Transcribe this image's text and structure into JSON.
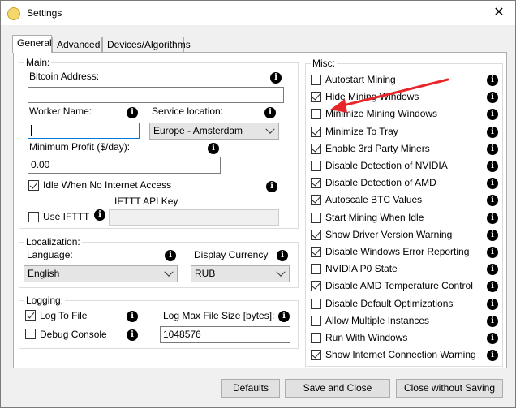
{
  "window": {
    "title": "Settings",
    "close_glyph": "✕"
  },
  "tabs": [
    {
      "label": "General",
      "active": true
    },
    {
      "label": "Advanced",
      "active": false
    },
    {
      "label": "Devices/Algorithms",
      "active": false
    }
  ],
  "main": {
    "legend": "Main:",
    "bitcoin_address_label": "Bitcoin Address:",
    "bitcoin_address_value": "",
    "worker_name_label": "Worker Name:",
    "worker_name_value": "",
    "service_location_label": "Service location:",
    "service_location_value": "Europe - Amsterdam",
    "min_profit_label": "Minimum Profit ($/day):",
    "min_profit_value": "0.00",
    "idle_no_internet_label": "Idle When No Internet Access",
    "idle_no_internet_checked": true,
    "use_ifttt_label": "Use IFTTT",
    "use_ifttt_checked": false,
    "ifttt_api_key_label": "IFTTT API Key",
    "ifttt_api_key_value": ""
  },
  "localization": {
    "legend": "Localization:",
    "language_label": "Language:",
    "language_value": "English",
    "currency_label": "Display Currency",
    "currency_value": "RUB"
  },
  "logging": {
    "legend": "Logging:",
    "log_to_file_label": "Log To File",
    "log_to_file_checked": true,
    "debug_console_label": "Debug Console",
    "debug_console_checked": false,
    "max_size_label": "Log Max File Size [bytes]:",
    "max_size_value": "1048576"
  },
  "misc": {
    "legend": "Misc:",
    "items": [
      {
        "label": "Autostart Mining",
        "checked": false
      },
      {
        "label": "Hide Mining Windows",
        "checked": true
      },
      {
        "label": "Minimize Mining Windows",
        "checked": false
      },
      {
        "label": "Minimize To Tray",
        "checked": true
      },
      {
        "label": "Enable 3rd Party Miners",
        "checked": true
      },
      {
        "label": "Disable Detection of NVIDIA",
        "checked": false
      },
      {
        "label": "Disable Detection of AMD",
        "checked": true
      },
      {
        "label": "Autoscale BTC Values",
        "checked": true
      },
      {
        "label": "Start Mining When Idle",
        "checked": false
      },
      {
        "label": "Show Driver Version Warning",
        "checked": true
      },
      {
        "label": "Disable Windows Error Reporting",
        "checked": true
      },
      {
        "label": "NVIDIA P0 State",
        "checked": false
      },
      {
        "label": "Disable AMD Temperature Control",
        "checked": true
      },
      {
        "label": "Disable Default Optimizations",
        "checked": false
      },
      {
        "label": "Allow Multiple Instances",
        "checked": false
      },
      {
        "label": "Run With Windows",
        "checked": false
      },
      {
        "label": "Show Internet Connection Warning",
        "checked": true
      }
    ]
  },
  "buttons": {
    "defaults_label": "Defaults",
    "save_close_label": "Save and Close",
    "close_no_save_label": "Close without Saving"
  },
  "icons": {
    "info": "i",
    "annotation_arrow_color": "#e8262a"
  }
}
